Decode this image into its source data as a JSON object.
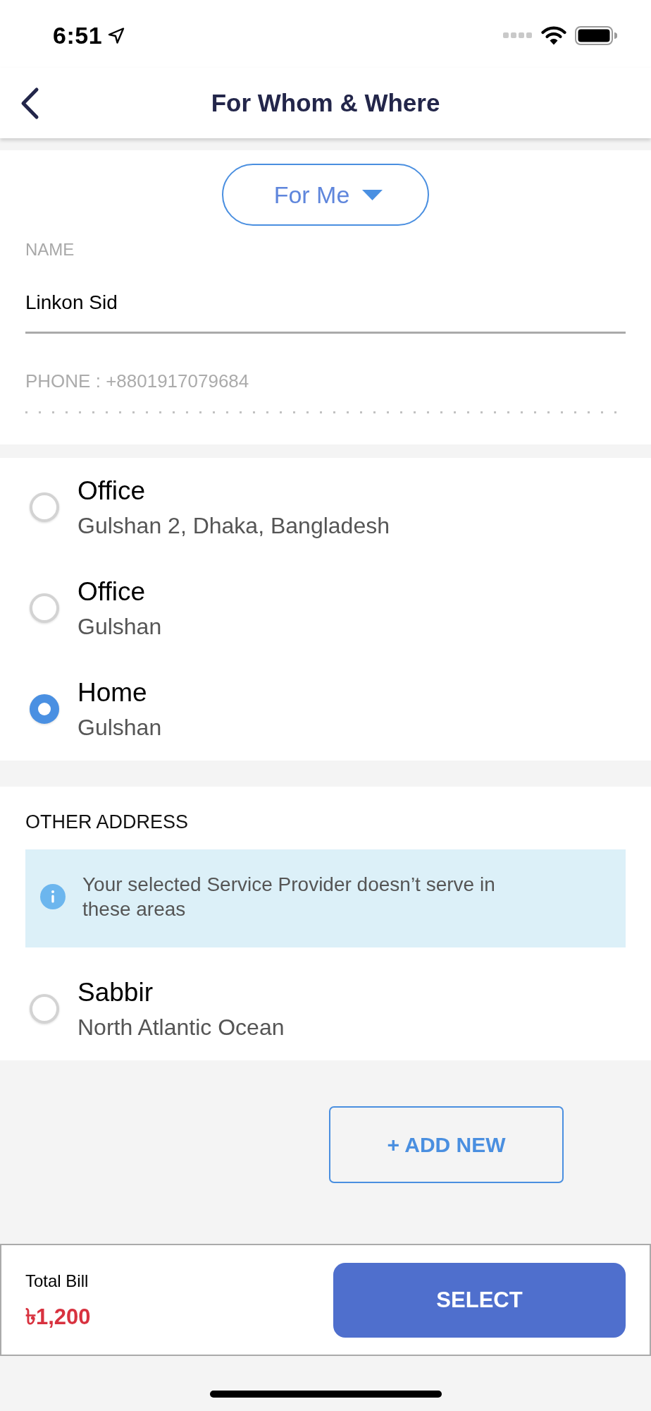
{
  "status_bar": {
    "time": "6:51"
  },
  "header": {
    "title": "For Whom & Where"
  },
  "recipient": {
    "selector": "For Me",
    "name": {
      "label": "NAME",
      "value": "Linkon Sid"
    },
    "phone": {
      "value": "PHONE : +8801917079684",
      "disabled": true
    }
  },
  "addresses": [
    {
      "title": "Office",
      "address": "Gulshan 2, Dhaka, Bangladesh",
      "selected": false
    },
    {
      "title": "Office",
      "address": "Gulshan",
      "selected": false
    },
    {
      "title": "Home",
      "address": "Gulshan",
      "selected": true
    }
  ],
  "other_addresses": {
    "heading": "OTHER ADDRESS",
    "notice": "Your selected Service Provider doesn’t serve in these areas",
    "items": [
      {
        "title": "Sabbir",
        "address": "North Atlantic Ocean",
        "selected": false
      }
    ]
  },
  "add_button": "+ ADD NEW",
  "footer": {
    "total_label": "Total Bill",
    "total": "৳1,200",
    "button": "SELECT"
  }
}
